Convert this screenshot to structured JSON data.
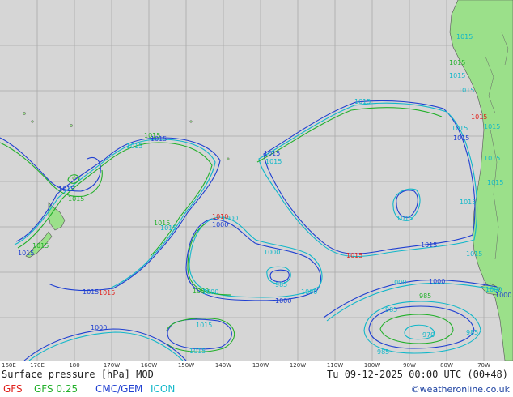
{
  "map": {
    "title": "Surface pressure [hPa] MOD",
    "valid_time": "Tu 09-12-2025 00:00 UTC (00+48)",
    "credit": "©weatheronline.co.uk",
    "longitude_labels": [
      "160E",
      "170E",
      "180",
      "170W",
      "160W",
      "150W",
      "140W",
      "130W",
      "120W",
      "110W",
      "100W",
      "90W",
      "80W",
      "70W"
    ],
    "models": [
      {
        "name": "GFS",
        "color": "#e0201b"
      },
      {
        "name": "GFS 0.25",
        "color": "#22b02a"
      },
      {
        "name": "CMC/GEM",
        "color": "#1f3fd1"
      },
      {
        "name": "ICON",
        "color": "#10b7c9"
      }
    ],
    "colors": {
      "ocean": "#d6d6d6",
      "land": "#9be08a",
      "grid": "#a9a9a9"
    },
    "isobar_labels": [
      {
        "text": "1015",
        "model": "CMC/GEM"
      },
      {
        "text": "1015",
        "model": "ICON"
      },
      {
        "text": "1015",
        "model": "GFS 0.25"
      },
      {
        "text": "1015",
        "model": "GFS"
      },
      {
        "text": "1010",
        "model": "GFS"
      },
      {
        "text": "1000",
        "model": "ICON"
      },
      {
        "text": "1000",
        "model": "CMC/GEM"
      },
      {
        "text": "1000",
        "model": "GFS 0.25"
      },
      {
        "text": "985",
        "model": "ICON"
      },
      {
        "text": "985",
        "model": "GFS 0.25"
      },
      {
        "text": "970",
        "model": "ICON"
      }
    ]
  }
}
